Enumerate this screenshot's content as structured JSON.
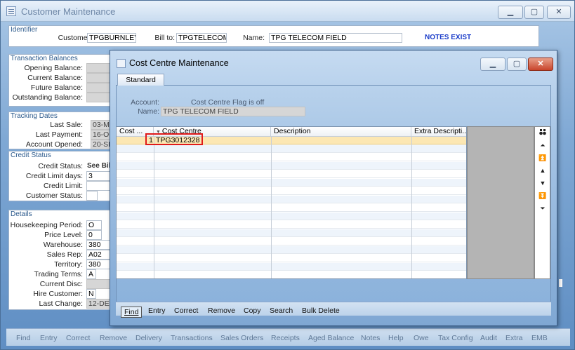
{
  "main_window": {
    "title": "Customer Maintenance",
    "controls": [
      "▁",
      "▢",
      "✕"
    ]
  },
  "identifier": {
    "section": "Identifier",
    "customer_label": "Customer:",
    "customer": "TPGBURNLEY",
    "billto_label": "Bill to:",
    "billto": "TPGTELECOM",
    "name_label": "Name:",
    "name": "TPG TELECOM FIELD",
    "notes": "NOTES EXIST"
  },
  "transaction_balances": {
    "section": "Transaction Balances",
    "labels": [
      "Opening Balance:",
      "Current Balance:",
      "Future Balance:",
      "Outstanding Balance:"
    ]
  },
  "tracking_dates": {
    "section": "Tracking Dates",
    "labels": [
      "Last Sale:",
      "Last Payment:",
      "Account Opened:"
    ],
    "values": [
      "03-MA",
      "16-OC",
      "20-SE"
    ]
  },
  "credit_status": {
    "section": "Credit Status",
    "labels": [
      "Credit Status:",
      "Credit Limit days:",
      "Credit Limit:",
      "Customer Status:"
    ],
    "values": [
      "See Bil",
      "3",
      "",
      ""
    ]
  },
  "details": {
    "section": "Details",
    "labels": [
      "Housekeeping Period:",
      "Price Level:",
      "Warehouse:",
      "Sales Rep:",
      "Territory:",
      "Trading Terms:",
      "Current Disc:",
      "Hire Customer:",
      "Last Change:"
    ],
    "values": [
      "O",
      "0",
      "380",
      "A02",
      "380",
      "A",
      "",
      "N",
      "12-DE"
    ]
  },
  "dialog": {
    "title": "Cost Centre Maintenance",
    "controls": [
      "▁",
      "▢",
      "✕"
    ],
    "tab": "Standard",
    "account_label": "Account:",
    "account_info": "Cost Centre Flag is off",
    "name_label": "Name:",
    "name": "TPG TELECOM FIELD",
    "columns": [
      "Cost ...",
      "Cost Centre",
      "Description",
      "Extra Descripti..."
    ],
    "rows": [
      {
        "num": "1",
        "cost_centre": "TPG3012328",
        "description": "",
        "extra": ""
      }
    ],
    "actions": [
      "Find",
      "Entry",
      "Correct",
      "Remove",
      "Copy",
      "Search",
      "Bulk Delete"
    ]
  },
  "nav_icons": [
    "binoculars-icon",
    "first-icon",
    "page-up-icon",
    "up-icon",
    "down-icon",
    "page-down-icon",
    "last-icon"
  ],
  "bottom_menu": [
    "Find",
    "Entry",
    "Correct",
    "Remove",
    "Delivery",
    "Transactions",
    "Sales Orders",
    "Receipts",
    "Aged Balance",
    "Notes",
    "Help",
    "Owe",
    "Tax Config",
    "Audit",
    "Extra",
    "EMB"
  ]
}
